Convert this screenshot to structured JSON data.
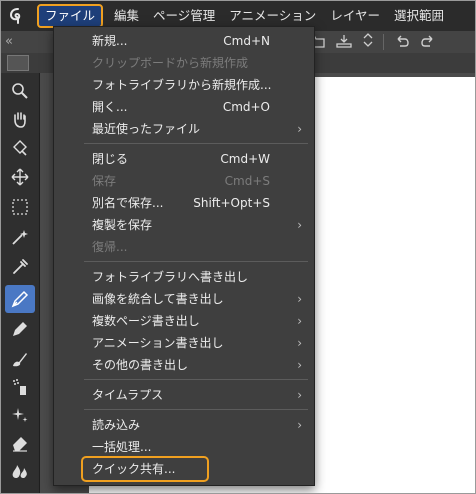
{
  "menubar": {
    "logo": "clip-studio-logo",
    "items": [
      "ファイル",
      "編集",
      "ページ管理",
      "アニメーション",
      "レイヤー",
      "選択範囲"
    ]
  },
  "toolbar_left": "«",
  "file_menu": {
    "items": [
      {
        "label": "新規...",
        "shortcut": "Cmd+N",
        "disabled": false,
        "submenu": false
      },
      {
        "label": "クリップボードから新規作成",
        "shortcut": "",
        "disabled": true,
        "submenu": false
      },
      {
        "label": "フォトライブラリから新規作成...",
        "shortcut": "",
        "disabled": false,
        "submenu": false
      },
      {
        "label": "開く...",
        "shortcut": "Cmd+O",
        "disabled": false,
        "submenu": false
      },
      {
        "label": "最近使ったファイル",
        "shortcut": "",
        "disabled": false,
        "submenu": true
      },
      {
        "label": "閉じる",
        "shortcut": "Cmd+W",
        "disabled": false,
        "submenu": false
      },
      {
        "label": "保存",
        "shortcut": "Cmd+S",
        "disabled": true,
        "submenu": false
      },
      {
        "label": "別名で保存...",
        "shortcut": "Shift+Opt+S",
        "disabled": false,
        "submenu": false
      },
      {
        "label": "複製を保存",
        "shortcut": "",
        "disabled": false,
        "submenu": true
      },
      {
        "label": "復帰...",
        "shortcut": "",
        "disabled": true,
        "submenu": false
      },
      {
        "label": "フォトライブラリへ書き出し",
        "shortcut": "",
        "disabled": false,
        "submenu": false
      },
      {
        "label": "画像を統合して書き出し",
        "shortcut": "",
        "disabled": false,
        "submenu": true
      },
      {
        "label": "複数ページ書き出し",
        "shortcut": "",
        "disabled": false,
        "submenu": true
      },
      {
        "label": "アニメーション書き出し",
        "shortcut": "",
        "disabled": false,
        "submenu": true
      },
      {
        "label": "その他の書き出し",
        "shortcut": "",
        "disabled": false,
        "submenu": true
      },
      {
        "label": "タイムラプス",
        "shortcut": "",
        "disabled": false,
        "submenu": true
      },
      {
        "label": "読み込み",
        "shortcut": "",
        "disabled": false,
        "submenu": true
      },
      {
        "label": "一括処理...",
        "shortcut": "",
        "disabled": false,
        "submenu": false
      },
      {
        "label": "クイック共有...",
        "shortcut": "",
        "disabled": false,
        "submenu": false,
        "highlighted": true
      }
    ],
    "arrow": "›"
  },
  "tools": [
    "zoom-icon",
    "hand-icon",
    "rotate-icon",
    "move-icon",
    "selection-icon",
    "magic-wand-icon",
    "eyedropper-icon",
    "pen-icon",
    "pencil-icon",
    "brush-icon",
    "airbrush-icon",
    "decoration-icon",
    "eraser-icon",
    "blend-icon"
  ],
  "colors": {
    "accent_highlight": "#f0a020",
    "selected_tool": "#4a78c4",
    "menubar_active": "#1e3f7a"
  }
}
